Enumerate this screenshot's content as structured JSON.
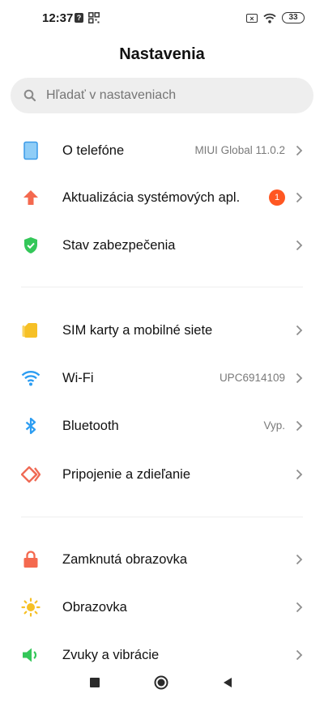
{
  "status_bar": {
    "time": "12:37",
    "notification_glyph": "?",
    "battery": "33",
    "icons": [
      "help-notification-icon",
      "qr-grid-icon",
      "no-sim-icon",
      "wifi-icon",
      "battery-icon"
    ]
  },
  "header": {
    "title": "Nastavenia"
  },
  "search": {
    "placeholder": "Hľadať v nastaveniach"
  },
  "sections": [
    [
      {
        "label": "O telefóne",
        "value": "MIUI Global 11.0.2",
        "icon": "phone-icon",
        "color": "#4aa3ee"
      },
      {
        "label": "Aktualizácia systémových apl.",
        "badge": "1",
        "icon": "arrow-up-icon",
        "color": "#f4694f"
      },
      {
        "label": "Stav zabezpečenia",
        "icon": "shield-check-icon",
        "color": "#34c759"
      }
    ],
    [
      {
        "label": "SIM karty a mobilné siete",
        "icon": "sim-card-icon",
        "color": "#f6c026"
      },
      {
        "label": "Wi-Fi",
        "value": "UPC6914109",
        "icon": "wifi-icon",
        "color": "#2c9df2"
      },
      {
        "label": "Bluetooth",
        "value": "Vyp.",
        "icon": "bluetooth-icon",
        "color": "#2c9df2"
      },
      {
        "label": "Pripojenie a zdieľanie",
        "icon": "connection-share-icon",
        "color": "#ef6a55"
      }
    ],
    [
      {
        "label": "Zamknutá obrazovka",
        "icon": "lock-icon",
        "color": "#f4694f"
      },
      {
        "label": "Obrazovka",
        "icon": "sun-icon",
        "color": "#f6c026"
      },
      {
        "label": "Zvuky a vibrácie",
        "icon": "speaker-icon",
        "color": "#34c759"
      }
    ]
  ],
  "navbar": {
    "icons": [
      "recents-square-icon",
      "home-circle-icon",
      "back-triangle-icon"
    ]
  }
}
